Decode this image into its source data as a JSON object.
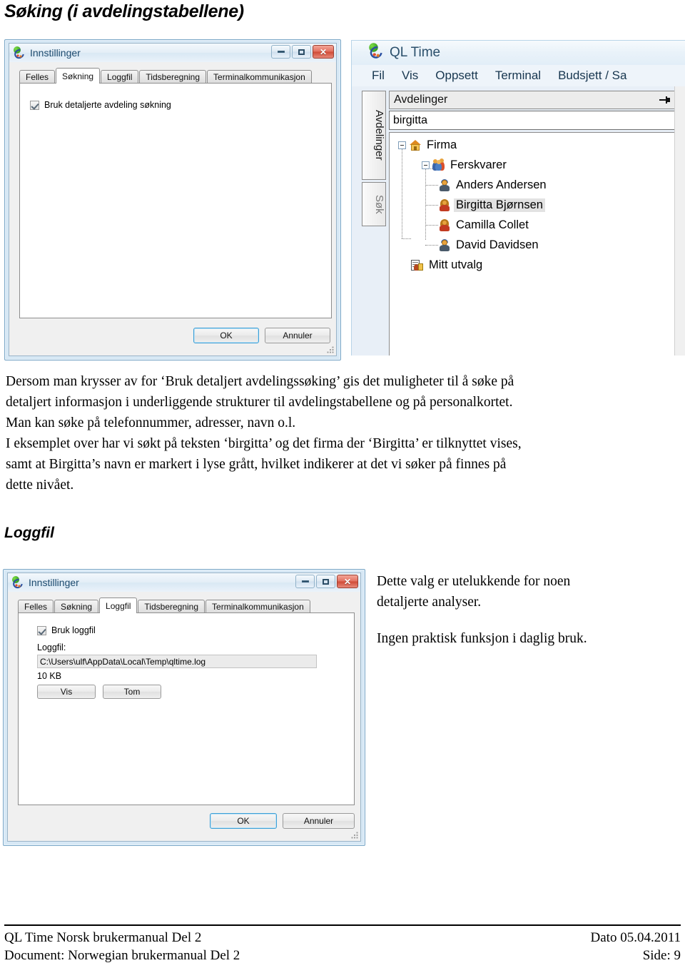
{
  "page": {
    "heading": "Søking (i avdelingstabellene)",
    "sub_heading": "Loggfil"
  },
  "paragraphs": {
    "p1_line1": "Dersom man krysser av for ‘Bruk detaljert avdelingssøking’ gis det muligheter til å søke på",
    "p1_line2": "detaljert informasjon i underliggende strukturer til avdelingstabellene og på personalkortet.",
    "p1_line3": "Man kan søke på telefonnummer, adresser, navn o.l.",
    "p2_line1": "I eksemplet over har vi søkt på teksten ‘birgitta’ og det firma der ‘Birgitta’ er tilknyttet vises,",
    "p2_line2": "samt at Birgitta’s navn er markert i lyse grått, hvilket indikerer at det vi søker på finnes på",
    "p2_line3": "dette nivået.",
    "side_note_1": "Dette valg er utelukkende for noen",
    "side_note_2": "detaljerte analyser.",
    "side_note_3": "Ingen praktisk funksjon i daglig bruk."
  },
  "settings_dialog_soking": {
    "title": "Innstillinger",
    "window_buttons": {
      "minimize": "minimize-glyph",
      "maximize": "maximize-glyph",
      "close": "✕"
    },
    "tabs": [
      {
        "label": "Felles",
        "active": false
      },
      {
        "label": "Søkning",
        "active": true
      },
      {
        "label": "Loggfil",
        "active": false
      },
      {
        "label": "Tidsberegning",
        "active": false
      },
      {
        "label": "Terminalkommunikasjon",
        "active": false
      }
    ],
    "checkbox": {
      "label": "Bruk detaljerte avdeling søkning",
      "checked": true
    },
    "buttons": {
      "ok": "OK",
      "cancel": "Annuler"
    }
  },
  "settings_dialog_loggfil": {
    "title": "Innstillinger",
    "tabs": [
      {
        "label": "Felles",
        "active": false
      },
      {
        "label": "Søkning",
        "active": false
      },
      {
        "label": "Loggfil",
        "active": true
      },
      {
        "label": "Tidsberegning",
        "active": false
      },
      {
        "label": "Terminalkommunikasjon",
        "active": false
      }
    ],
    "checkbox": {
      "label": "Bruk loggfil",
      "checked": true
    },
    "field_label": "Loggfil:",
    "field_value": "C:\\Users\\ulf\\AppData\\Local\\Temp\\qltime.log",
    "size_label": "10 KB",
    "buttons": {
      "view": "Vis",
      "empty": "Tom",
      "ok": "OK",
      "cancel": "Annuler"
    }
  },
  "qltime_window": {
    "title": "QL Time",
    "menu": [
      "Fil",
      "Vis",
      "Oppsett",
      "Terminal",
      "Budsjett / Sa"
    ],
    "vertical_tabs": [
      {
        "label": "Avdelinger",
        "active": true
      },
      {
        "label": "Søk",
        "active": false
      }
    ],
    "panel_header": "Avdelinger",
    "search_value": "birgitta",
    "tree": [
      {
        "label": "Firma",
        "icon": "house-icon",
        "level": 0,
        "expanded": true,
        "selected": false
      },
      {
        "label": "Ferskvarer",
        "icon": "group-icon",
        "level": 1,
        "expanded": true,
        "selected": false
      },
      {
        "label": "Anders Andersen",
        "icon": "person-blue-icon",
        "level": 2,
        "expanded": false,
        "selected": false
      },
      {
        "label": "Birgitta Bjørnsen",
        "icon": "person-red-icon",
        "level": 2,
        "expanded": false,
        "selected": true
      },
      {
        "label": "Camilla Collet",
        "icon": "person-red-icon",
        "level": 2,
        "expanded": false,
        "selected": false
      },
      {
        "label": "David Davidsen",
        "icon": "person-blue-icon",
        "level": 2,
        "expanded": false,
        "selected": false
      },
      {
        "label": "Mitt utvalg",
        "icon": "doc-icon",
        "level": 0,
        "expanded": false,
        "selected": false
      }
    ]
  },
  "footer": {
    "left_line1": "QL Time Norsk brukermanual Del 2",
    "left_line2": "Document: Norwegian brukermanual Del 2",
    "right_line1": "Dato 05.04.2011",
    "right_line2": "Side: 9"
  },
  "colors": {
    "aero_border": "#d7e8f5",
    "close_button_red": "#cf4a35",
    "selection_gray": "#e2e2e2",
    "title_text": "#1c4a6e"
  }
}
